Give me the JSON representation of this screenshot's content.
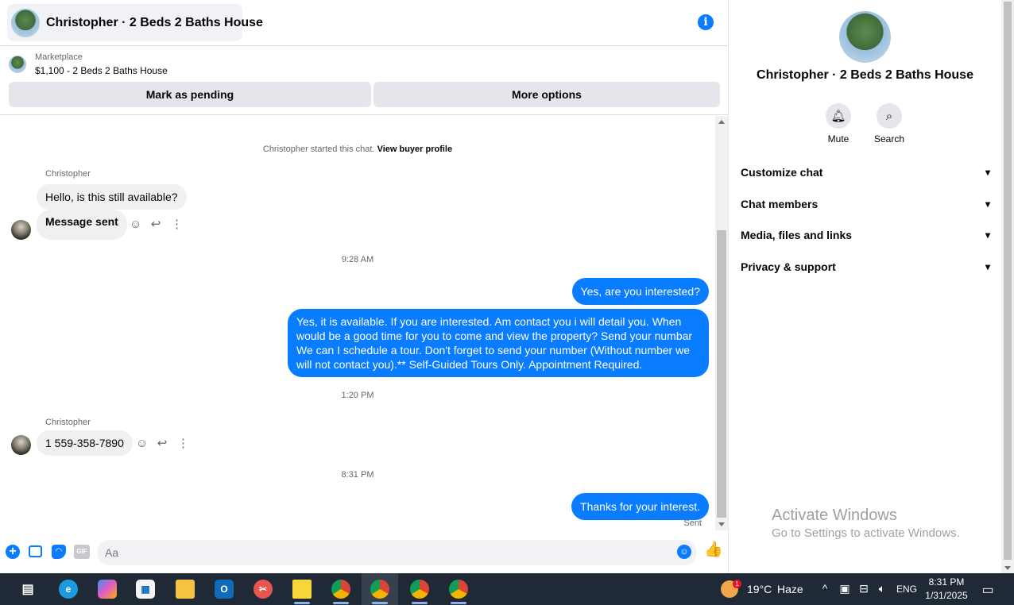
{
  "header": {
    "title": "Christopher · 2 Beds 2 Baths House",
    "info_icon": "info-icon"
  },
  "listing": {
    "kind": "Marketplace",
    "price_title": "$1,100 - 2 Beds 2 Baths House",
    "pending_label": "Mark as pending",
    "more_label": "More options"
  },
  "messages": {
    "started_note": "Christopher started this chat.",
    "buyer_profile_link": "View buyer profile",
    "sender_1": "Christopher",
    "in_1": "Hello, is this still available?",
    "in_2": "Message sent",
    "time_1": "9:28 AM",
    "out_1": "Yes, are you interested?",
    "out_2": "Yes, it is available. If you are interested.  Am contact you i will detail you.  When would be a good time for you to come and view the property? Send your numbar We can I schedule a tour.  Don't forget to send your number (Without number we will not contact you).** Self-Guided Tours Only. Appointment Required.",
    "time_2": "1:20 PM",
    "sender_2": "Christopher",
    "in_3": "1 559-358-7890",
    "time_3": "8:31 PM",
    "out_3": "Thanks for your interest.",
    "sent_label": "Sent"
  },
  "composer": {
    "placeholder": "Aa"
  },
  "info_panel": {
    "title": "Christopher · 2 Beds 2 Baths House",
    "mute_label": "Mute",
    "search_label": "Search",
    "sections": [
      "Customize chat",
      "Chat members",
      "Media, files and links",
      "Privacy & support"
    ]
  },
  "watermark": {
    "line1": "Activate Windows",
    "line2": "Go to Settings to activate Windows."
  },
  "taskbar": {
    "weather_temp": "19°C",
    "weather_desc": "Haze",
    "weather_badge": "1",
    "language": "ENG",
    "time": "8:31 PM",
    "date": "1/31/2025"
  },
  "colors": {
    "accent": "#0a7cff",
    "bubble_in": "#f0f0f0",
    "taskbar": "#1f2a36"
  }
}
